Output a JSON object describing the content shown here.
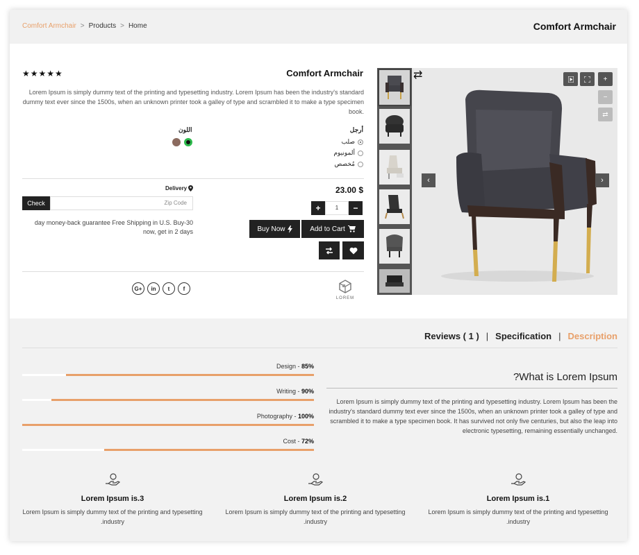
{
  "breadcrumb": {
    "current": "Comfort Armchair",
    "items": [
      "Products",
      "Home"
    ],
    "separator": ">"
  },
  "header": {
    "title": "Comfort Armchair"
  },
  "product": {
    "title": "Comfort Armchair",
    "rating_stars": "★★★★★",
    "rating": 5,
    "description": "Lorem Ipsum is simply dummy text of the printing and typesetting industry. Lorem Ipsum has been the industry's standard dummy text ever since the 1500s, when an unknown printer took a galley of type and scrambled it to make a type specimen book.",
    "color_label": "اللون",
    "colors": [
      "#8b6b5f",
      "#111111"
    ],
    "legs_label": "أرجل",
    "leg_options": [
      {
        "label": "صلب",
        "selected": true
      },
      {
        "label": "ألمونيوم",
        "selected": false
      },
      {
        "label": "مُخصص",
        "selected": false
      }
    ],
    "price": "23.00 $",
    "quantity": "1",
    "plus": "+",
    "minus": "−",
    "buy_now": "Buy Now",
    "add_to_cart": "Add to Cart",
    "delivery_label": "Delivery",
    "check_label": "Check",
    "zip_placeholder": "Zip Code",
    "guarantee": "day money-back guarantee Free Shipping in U.S. Buy-30 now, get in 2 days",
    "social": [
      "G+",
      "in",
      "t",
      "f"
    ],
    "brand_name": "LOREM"
  },
  "tabs": {
    "reviews": "Reviews ( 1 )",
    "specification": "Specification",
    "description": "Description",
    "separator": "|"
  },
  "skills": [
    {
      "name": "Design",
      "percent": "85%",
      "value": 85
    },
    {
      "name": "Writing",
      "percent": "90%",
      "value": 90
    },
    {
      "name": "Photography",
      "percent": "100%",
      "value": 100
    },
    {
      "name": "Cost",
      "percent": "72%",
      "value": 72
    }
  ],
  "about": {
    "title": "?What is Lorem Ipsum",
    "text": "Lorem Ipsum is simply dummy text of the printing and typesetting industry. Lorem Ipsum has been the industry's standard dummy text ever since the 1500s, when an unknown printer took a galley of type and scrambled it to make a type specimen book. It has survived not only five centuries, but also the leap into electronic typesetting, remaining essentially unchanged."
  },
  "features": [
    {
      "title": "Lorem Ipsum is.3",
      "text": "Lorem Ipsum is simply dummy text of the printing and typesetting .industry"
    },
    {
      "title": "Lorem Ipsum is.2",
      "text": "Lorem Ipsum is simply dummy text of the printing and typesetting .industry"
    },
    {
      "title": "Lorem Ipsum is.1",
      "text": "Lorem Ipsum is simply dummy text of the printing and typesetting .industry"
    }
  ],
  "colors": {
    "accent": "#e8a06a",
    "dark": "#222222"
  }
}
